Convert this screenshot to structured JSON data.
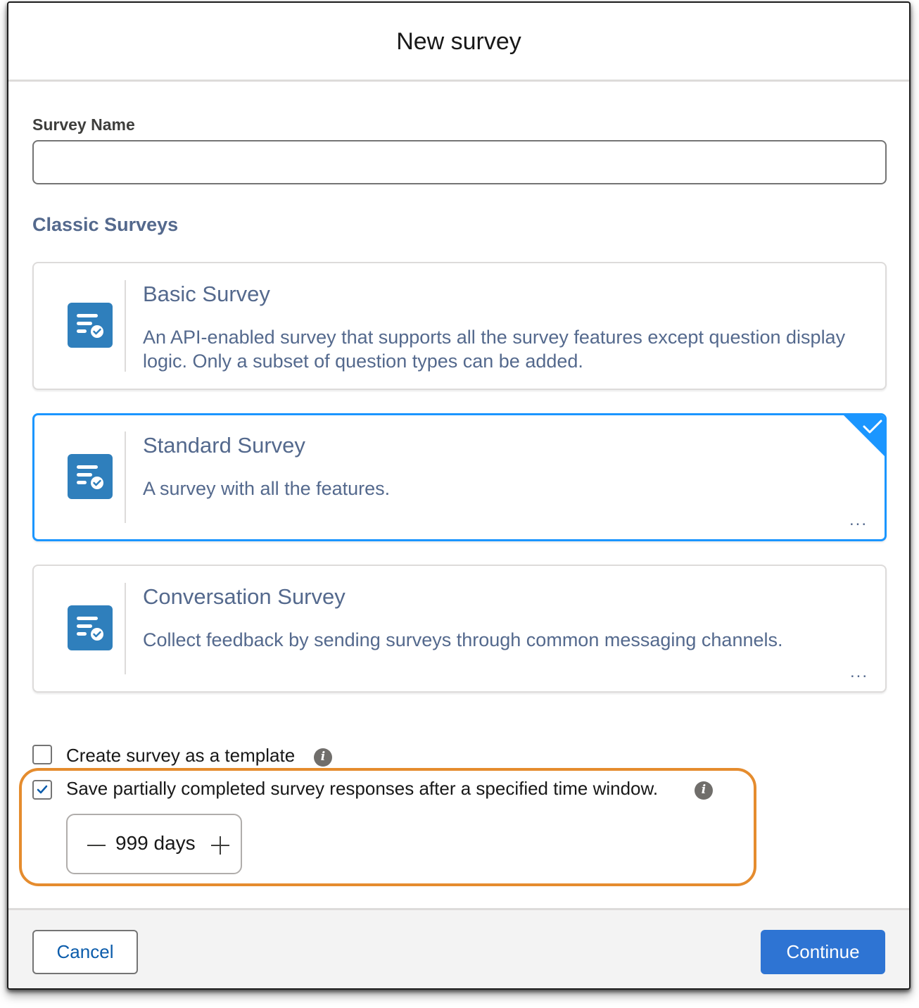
{
  "dialog": {
    "title": "New survey"
  },
  "form": {
    "survey_name_label": "Survey Name",
    "survey_name_value": "",
    "section_title": "Classic Surveys"
  },
  "survey_types": [
    {
      "title": "Basic Survey",
      "description": "An API-enabled survey that supports all the survey features except question display logic. Only a subset of question types can be added.",
      "selected": false,
      "more": ""
    },
    {
      "title": "Standard Survey",
      "description": "A survey with all the features.",
      "selected": true,
      "more": "..."
    },
    {
      "title": "Conversation Survey",
      "description": "Collect feedback by sending surveys through common messaging channels.",
      "selected": false,
      "more": "..."
    }
  ],
  "options": {
    "template_label": "Create survey as a template",
    "template_checked": false,
    "partial_label": "Save partially completed survey responses after a specified time window.",
    "partial_checked": true,
    "days_value": "999",
    "days_unit": "days"
  },
  "footer": {
    "cancel_label": "Cancel",
    "continue_label": "Continue"
  },
  "colors": {
    "accent": "#1b96ff",
    "icon_bg": "#2f7fbc",
    "highlight": "#e58c2e",
    "primary_button": "#2e74d3"
  },
  "icons": {
    "survey": "survey-form-icon",
    "info": "info-icon",
    "check": "check-icon"
  }
}
